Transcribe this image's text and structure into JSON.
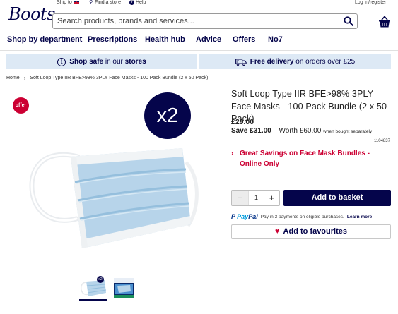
{
  "top_bar": {
    "ship_to": "Ship to",
    "find_store": "Find a store",
    "help": "Help",
    "login": "Log in/register"
  },
  "logo_text": "Boots",
  "search": {
    "placeholder": "Search products, brands and services..."
  },
  "nav": [
    "Shop by department",
    "Prescriptions",
    "Health hub",
    "Advice",
    "Offers",
    "No7"
  ],
  "banners": {
    "shop_safe_bold": "Shop safe",
    "shop_safe_rest": "in our",
    "shop_safe_stores": "stores",
    "delivery_bold": "Free delivery",
    "delivery_rest": "on orders over £25"
  },
  "breadcrumb": {
    "home": "Home",
    "current": "Soft Loop Type IIR BFE>98% 3PLY Face Masks - 100 Pack Bundle (2 x 50 Pack)"
  },
  "gallery": {
    "offer_badge": "offer",
    "multipack_badge": "x2",
    "thumb_badge": "x2"
  },
  "product": {
    "title": "Soft Loop Type IIR BFE>98% 3PLY Face Masks - 100 Pack Bundle (2 x 50 Pack)",
    "price": "£29.00",
    "save": "Save £31.00",
    "worth": "Worth £60.00",
    "worth_note": "when bought separately",
    "code": "1104837",
    "promo": "Great Savings on Face Mask Bundles - Online Only"
  },
  "purchase": {
    "qty_minus": "−",
    "qty_value": "1",
    "qty_plus": "+",
    "add_to_basket": "Add to basket",
    "paypal_text": "Pay in 3 payments on eligible purchases.",
    "paypal_learn": "Learn more",
    "add_to_favourites": "Add to favourites"
  },
  "colors": {
    "brand_navy": "#05054b",
    "offer_red": "#cc0033",
    "banner_blue": "#dde9f5"
  }
}
